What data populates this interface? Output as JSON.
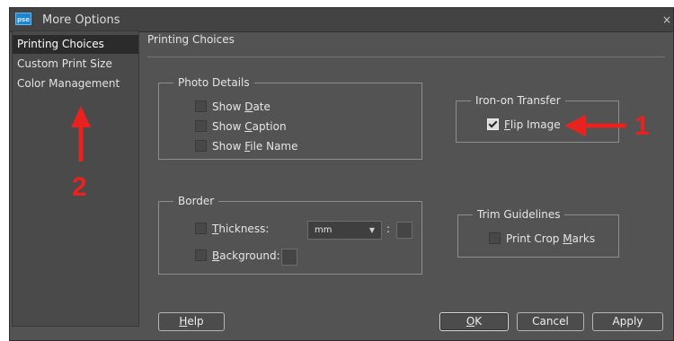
{
  "window": {
    "title": "More Options",
    "app_icon_text": "pse",
    "close_glyph": "×"
  },
  "sidebar": {
    "items": [
      {
        "label": "Printing Choices",
        "selected": true
      },
      {
        "label": "Custom Print Size",
        "selected": false
      },
      {
        "label": "Color Management",
        "selected": false
      }
    ]
  },
  "main": {
    "title": "Printing Choices",
    "photo_details": {
      "legend": "Photo Details",
      "options": [
        {
          "prefix": "Show ",
          "accel": "D",
          "suffix": "ate",
          "checked": false
        },
        {
          "prefix": "Show ",
          "accel": "C",
          "suffix": "aption",
          "checked": false
        },
        {
          "prefix": "Show ",
          "accel": "F",
          "suffix": "ile Name",
          "checked": false
        }
      ]
    },
    "iron_on_transfer": {
      "legend": "Iron-on Transfer",
      "flip_image": {
        "accel": "F",
        "suffix": "lip Image",
        "checked": true
      }
    },
    "border": {
      "legend": "Border",
      "thickness": {
        "accel": "T",
        "suffix": "hickness:",
        "checked": false
      },
      "unit_select": {
        "value": "mm"
      },
      "colon": ":",
      "background": {
        "accel": "B",
        "suffix": "ackground:",
        "checked": false
      }
    },
    "trim_guidelines": {
      "legend": "Trim Guidelines",
      "print_crop_marks": {
        "prefix": "Print Crop ",
        "accel": "M",
        "suffix": "arks",
        "checked": false
      }
    }
  },
  "buttons": {
    "help": {
      "accel": "H",
      "suffix": "elp"
    },
    "ok": {
      "accel": "O",
      "suffix": "K"
    },
    "cancel": {
      "label": "Cancel"
    },
    "apply": {
      "label": "Apply"
    }
  },
  "annotations": {
    "arrow_color": "#e8231f",
    "label_1": "1",
    "label_2": "2"
  }
}
